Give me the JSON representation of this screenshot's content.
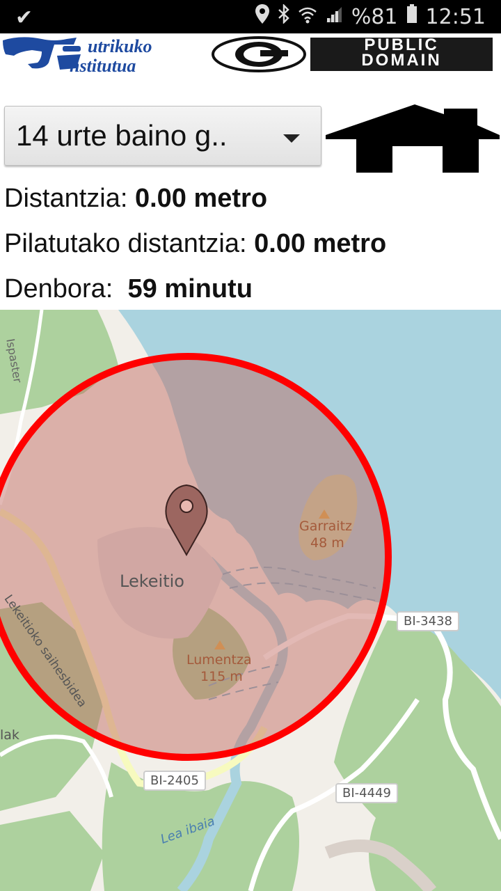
{
  "status_bar": {
    "battery_percent": "%81",
    "time": "12:51"
  },
  "banner": {
    "left_logo_text": [
      "utrikuko",
      "nstitutua"
    ],
    "right_logo_text": [
      "PUBLIC",
      "DOMAIN"
    ]
  },
  "spinner": {
    "selected": "14 urte baino g.."
  },
  "info": {
    "distance_label": "Distantzia:",
    "distance_value": "0.00 metro",
    "accumulated_label": "Pilatutako distantzia:",
    "accumulated_value": "0.00 metro",
    "time_label": "Denbora:",
    "time_value": "59 minutu"
  },
  "map": {
    "town": "Lekeitio",
    "peak1_name": "Garraitz",
    "peak1_height": "48 m",
    "peak2_name": "Lumentza",
    "peak2_height": "115 m",
    "road1": "BI-3438",
    "road2": "BI-2405",
    "road3": "BI-4449",
    "street1": "Ispaster",
    "street2": "Lekeitioko saihesbidea",
    "river": "Lea ibaia",
    "edge_label": "lak",
    "colors": {
      "sea": "#aad3df",
      "land": "#f2efe9",
      "forest": "#add19e",
      "circle_stroke": "#ff0000",
      "circle_fill": "rgba(190,100,90,0.45)",
      "marker": "#9c6660"
    }
  }
}
